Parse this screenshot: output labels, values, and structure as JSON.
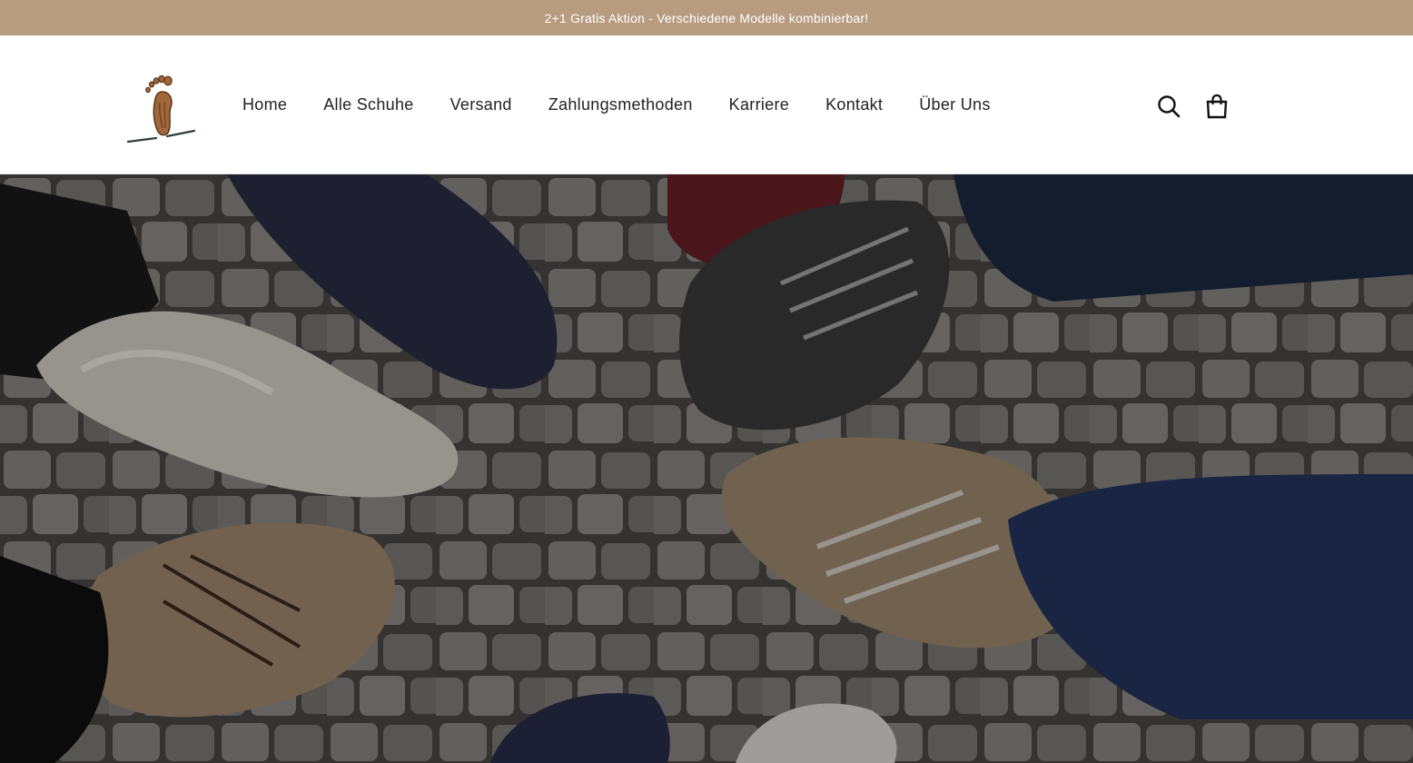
{
  "announcement": {
    "text": "2+1 Gratis Aktion - Verschiedene Modelle kombinierbar!",
    "background": "#b89c80",
    "color": "#ffffff"
  },
  "header": {
    "logo": {
      "icon": "footprint-logo-icon"
    },
    "nav": {
      "items": [
        {
          "label": "Home"
        },
        {
          "label": "Alle Schuhe"
        },
        {
          "label": "Versand"
        },
        {
          "label": "Zahlungsmethoden"
        },
        {
          "label": "Karriere"
        },
        {
          "label": "Kontakt"
        },
        {
          "label": "Über Uns"
        }
      ]
    },
    "icons": {
      "search": "search-icon",
      "cart": "shopping-bag-icon"
    }
  },
  "hero": {
    "image": "circle-of-shoes-on-cobblestones-photo",
    "overlay_color": "#000000"
  },
  "colors": {
    "accent": "#b89c80",
    "text": "#222222"
  }
}
